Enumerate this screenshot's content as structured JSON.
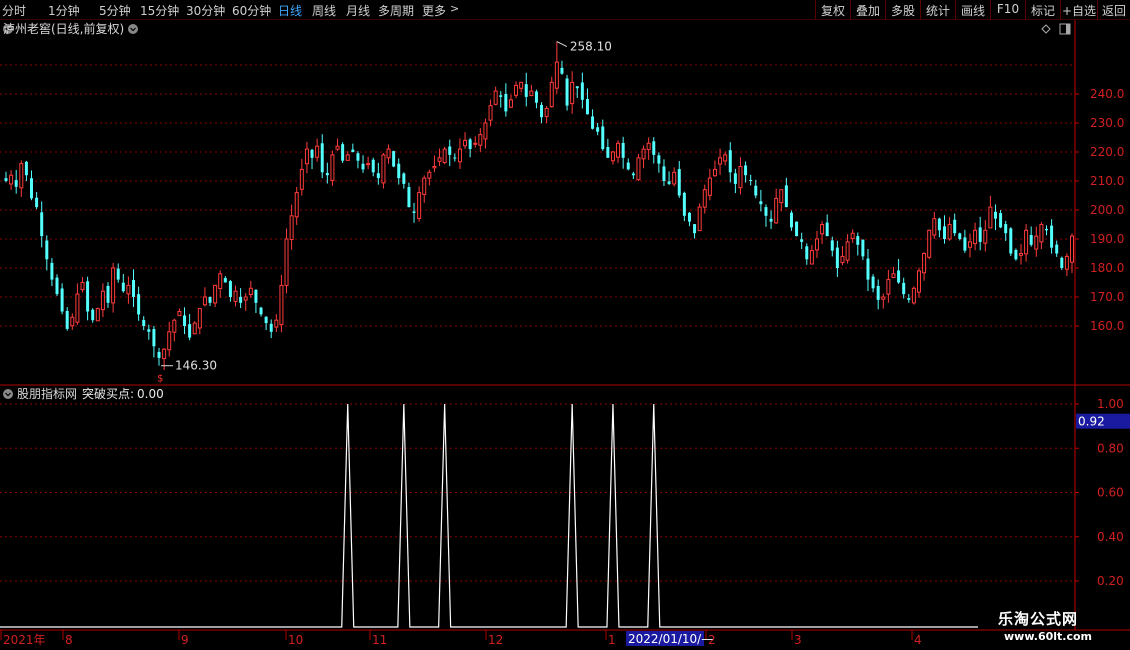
{
  "toolbar": {
    "periods": [
      {
        "label": "分时",
        "active": false
      },
      {
        "label": "1分钟",
        "active": false
      },
      {
        "label": "5分钟",
        "active": false
      },
      {
        "label": "15分钟",
        "active": false
      },
      {
        "label": "30分钟",
        "active": false
      },
      {
        "label": "60分钟",
        "active": false
      },
      {
        "label": "日线",
        "active": true
      },
      {
        "label": "周线",
        "active": false
      },
      {
        "label": "月线",
        "active": false
      },
      {
        "label": "多周期",
        "active": false
      },
      {
        "label": "更多",
        "active": false
      }
    ],
    "more_arrow": ">",
    "tools": [
      "复权",
      "叠加",
      "多股",
      "统计",
      "画线",
      "F10",
      "标记",
      "+自选",
      "返回"
    ]
  },
  "main_chart": {
    "title": "泸州老窖(日线,前复权)",
    "high_label": "258.10",
    "low_label": "146.30",
    "price_axis_ticks": [
      "240.0",
      "230.0",
      "220.0",
      "210.0",
      "200.0",
      "190.0",
      "180.0",
      "170.0",
      "160.0"
    ]
  },
  "indicator": {
    "name": "股朋指标网",
    "line_label": "突破买点:",
    "value": "0.00",
    "axis_ticks": [
      "1.00",
      "0.80",
      "0.60",
      "0.40",
      "0.20"
    ],
    "current_tag": "0.92"
  },
  "time_axis": {
    "labels": [
      "2021年",
      "8",
      "9",
      "10",
      "11",
      "12",
      "1",
      "2",
      "3",
      "4"
    ],
    "cursor_date": "2022/01/10/—"
  },
  "watermark": {
    "line1": "乐淘公式网",
    "line2": "www.60lt.com"
  },
  "colors": {
    "up": "#ff3b3b",
    "down": "#54ffff",
    "grid": "#8b0000",
    "axis": "#c00000",
    "active_period": "#3fa9ff",
    "indicator_line": "#ffffff"
  },
  "chart_data": [
    {
      "type": "candlestick",
      "title": "泸州老窖(日线,前复权)",
      "y_range": [
        146.3,
        258.1
      ],
      "close": [
        210,
        212,
        208,
        216,
        212,
        204,
        201,
        191,
        183,
        176,
        171,
        165,
        159,
        163,
        171,
        175,
        165,
        162,
        166,
        172,
        168,
        180,
        176,
        172,
        174,
        170,
        164,
        160,
        158,
        153,
        149,
        152,
        158,
        162,
        165,
        160,
        156,
        161,
        166,
        170,
        168,
        174,
        178,
        175,
        170,
        172,
        168,
        170,
        173,
        168,
        164,
        161,
        158,
        162,
        174,
        190,
        198,
        206,
        214,
        221,
        218,
        222,
        213,
        212,
        219,
        222,
        217,
        219,
        220,
        217,
        214,
        216,
        213,
        211,
        219,
        221,
        215,
        211,
        209,
        201,
        199,
        206,
        211,
        213,
        215,
        218,
        221,
        219,
        218,
        221,
        224,
        221,
        223,
        226,
        230,
        236,
        241,
        239,
        234,
        238,
        243,
        244,
        239,
        241,
        237,
        232,
        235,
        244,
        251,
        247,
        236,
        244,
        242,
        238,
        233,
        228,
        227,
        221,
        218,
        220,
        223,
        218,
        214,
        212,
        218,
        221,
        223,
        219,
        216,
        210,
        209,
        213,
        205,
        198,
        196,
        192,
        201,
        207,
        211,
        214,
        218,
        219,
        213,
        209,
        215,
        212,
        210,
        205,
        202,
        198,
        196,
        204,
        207,
        201,
        194,
        191,
        189,
        183,
        186,
        190,
        195,
        191,
        186,
        180,
        184,
        189,
        192,
        188,
        184,
        176,
        173,
        169,
        170,
        176,
        178,
        175,
        171,
        169,
        173,
        179,
        185,
        193,
        197,
        193,
        190,
        195,
        192,
        190,
        186,
        189,
        193,
        189,
        193,
        201,
        197,
        194,
        192,
        185,
        183,
        185,
        193,
        188,
        191,
        195,
        193,
        187,
        185,
        180,
        184,
        191
      ],
      "low": 146.3,
      "high": 258.1
    },
    {
      "type": "line",
      "title": "突破买点",
      "y_range": [
        0,
        1
      ],
      "spikes_at_index": [
        67,
        78,
        86,
        111,
        119,
        127
      ],
      "value_last": 0.0
    }
  ]
}
